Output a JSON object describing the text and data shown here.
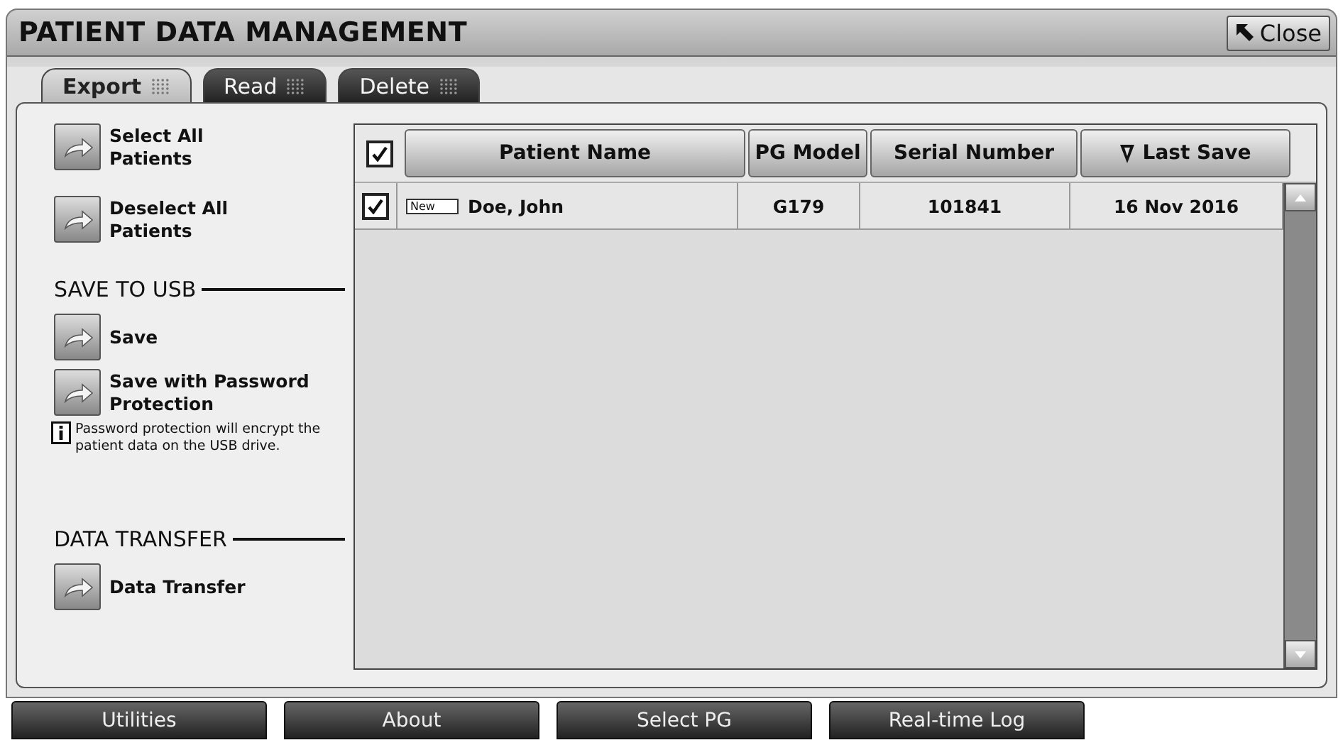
{
  "window": {
    "title": "PATIENT DATA MANAGEMENT",
    "close_button": "Close"
  },
  "tabs": [
    {
      "label": "Export",
      "selected": true
    },
    {
      "label": "Read",
      "selected": false
    },
    {
      "label": "Delete",
      "selected": false
    }
  ],
  "actions": [
    {
      "kind": "button",
      "label": "Select All Patients"
    },
    {
      "kind": "button",
      "label": "Deselect All Patients"
    },
    {
      "kind": "heading",
      "label": "SAVE TO USB"
    },
    {
      "kind": "button",
      "label": "Save"
    },
    {
      "kind": "button",
      "label": "Save with Password Protection"
    },
    {
      "kind": "info",
      "label": "Password protection will encrypt the patient data on the USB drive."
    },
    {
      "kind": "heading",
      "label": "DATA TRANSFER"
    },
    {
      "kind": "button",
      "label": "Data Transfer"
    }
  ],
  "table": {
    "select_all_checked": true,
    "columns": [
      {
        "label": "Patient Name",
        "sorted": false
      },
      {
        "label": "PG Model",
        "sorted": false
      },
      {
        "label": "Serial Number",
        "sorted": false
      },
      {
        "label": "Last Save",
        "sorted": true
      }
    ],
    "rows": [
      {
        "checked": true,
        "badge": "New",
        "patient_name": "Doe, John",
        "pg_model": "G179",
        "serial_number": "101841",
        "last_save": "16 Nov 2016"
      }
    ]
  },
  "bottom_buttons": [
    "Utilities",
    "About",
    "Select PG",
    "Real-time Log"
  ]
}
